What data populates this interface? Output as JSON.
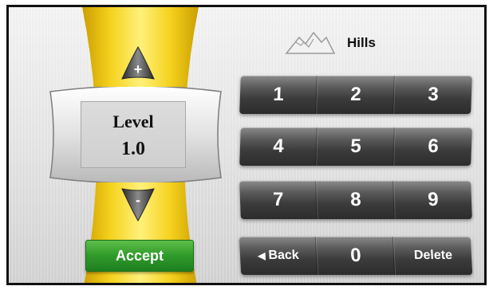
{
  "level": {
    "label": "Level",
    "value": "1.0",
    "increase_label": "+",
    "decrease_label": "-"
  },
  "mode": {
    "icon": "mountain-icon",
    "label": "Hills"
  },
  "keypad": {
    "rows": [
      [
        "1",
        "2",
        "3"
      ],
      [
        "4",
        "5",
        "6"
      ],
      [
        "7",
        "8",
        "9"
      ]
    ],
    "back_label": "Back",
    "zero_label": "0",
    "delete_label": "Delete"
  },
  "accept_label": "Accept",
  "colors": {
    "accent_yellow": "#f2cf1e",
    "accept_green": "#2f9a2a",
    "key_dark": "#3b3b3b"
  }
}
